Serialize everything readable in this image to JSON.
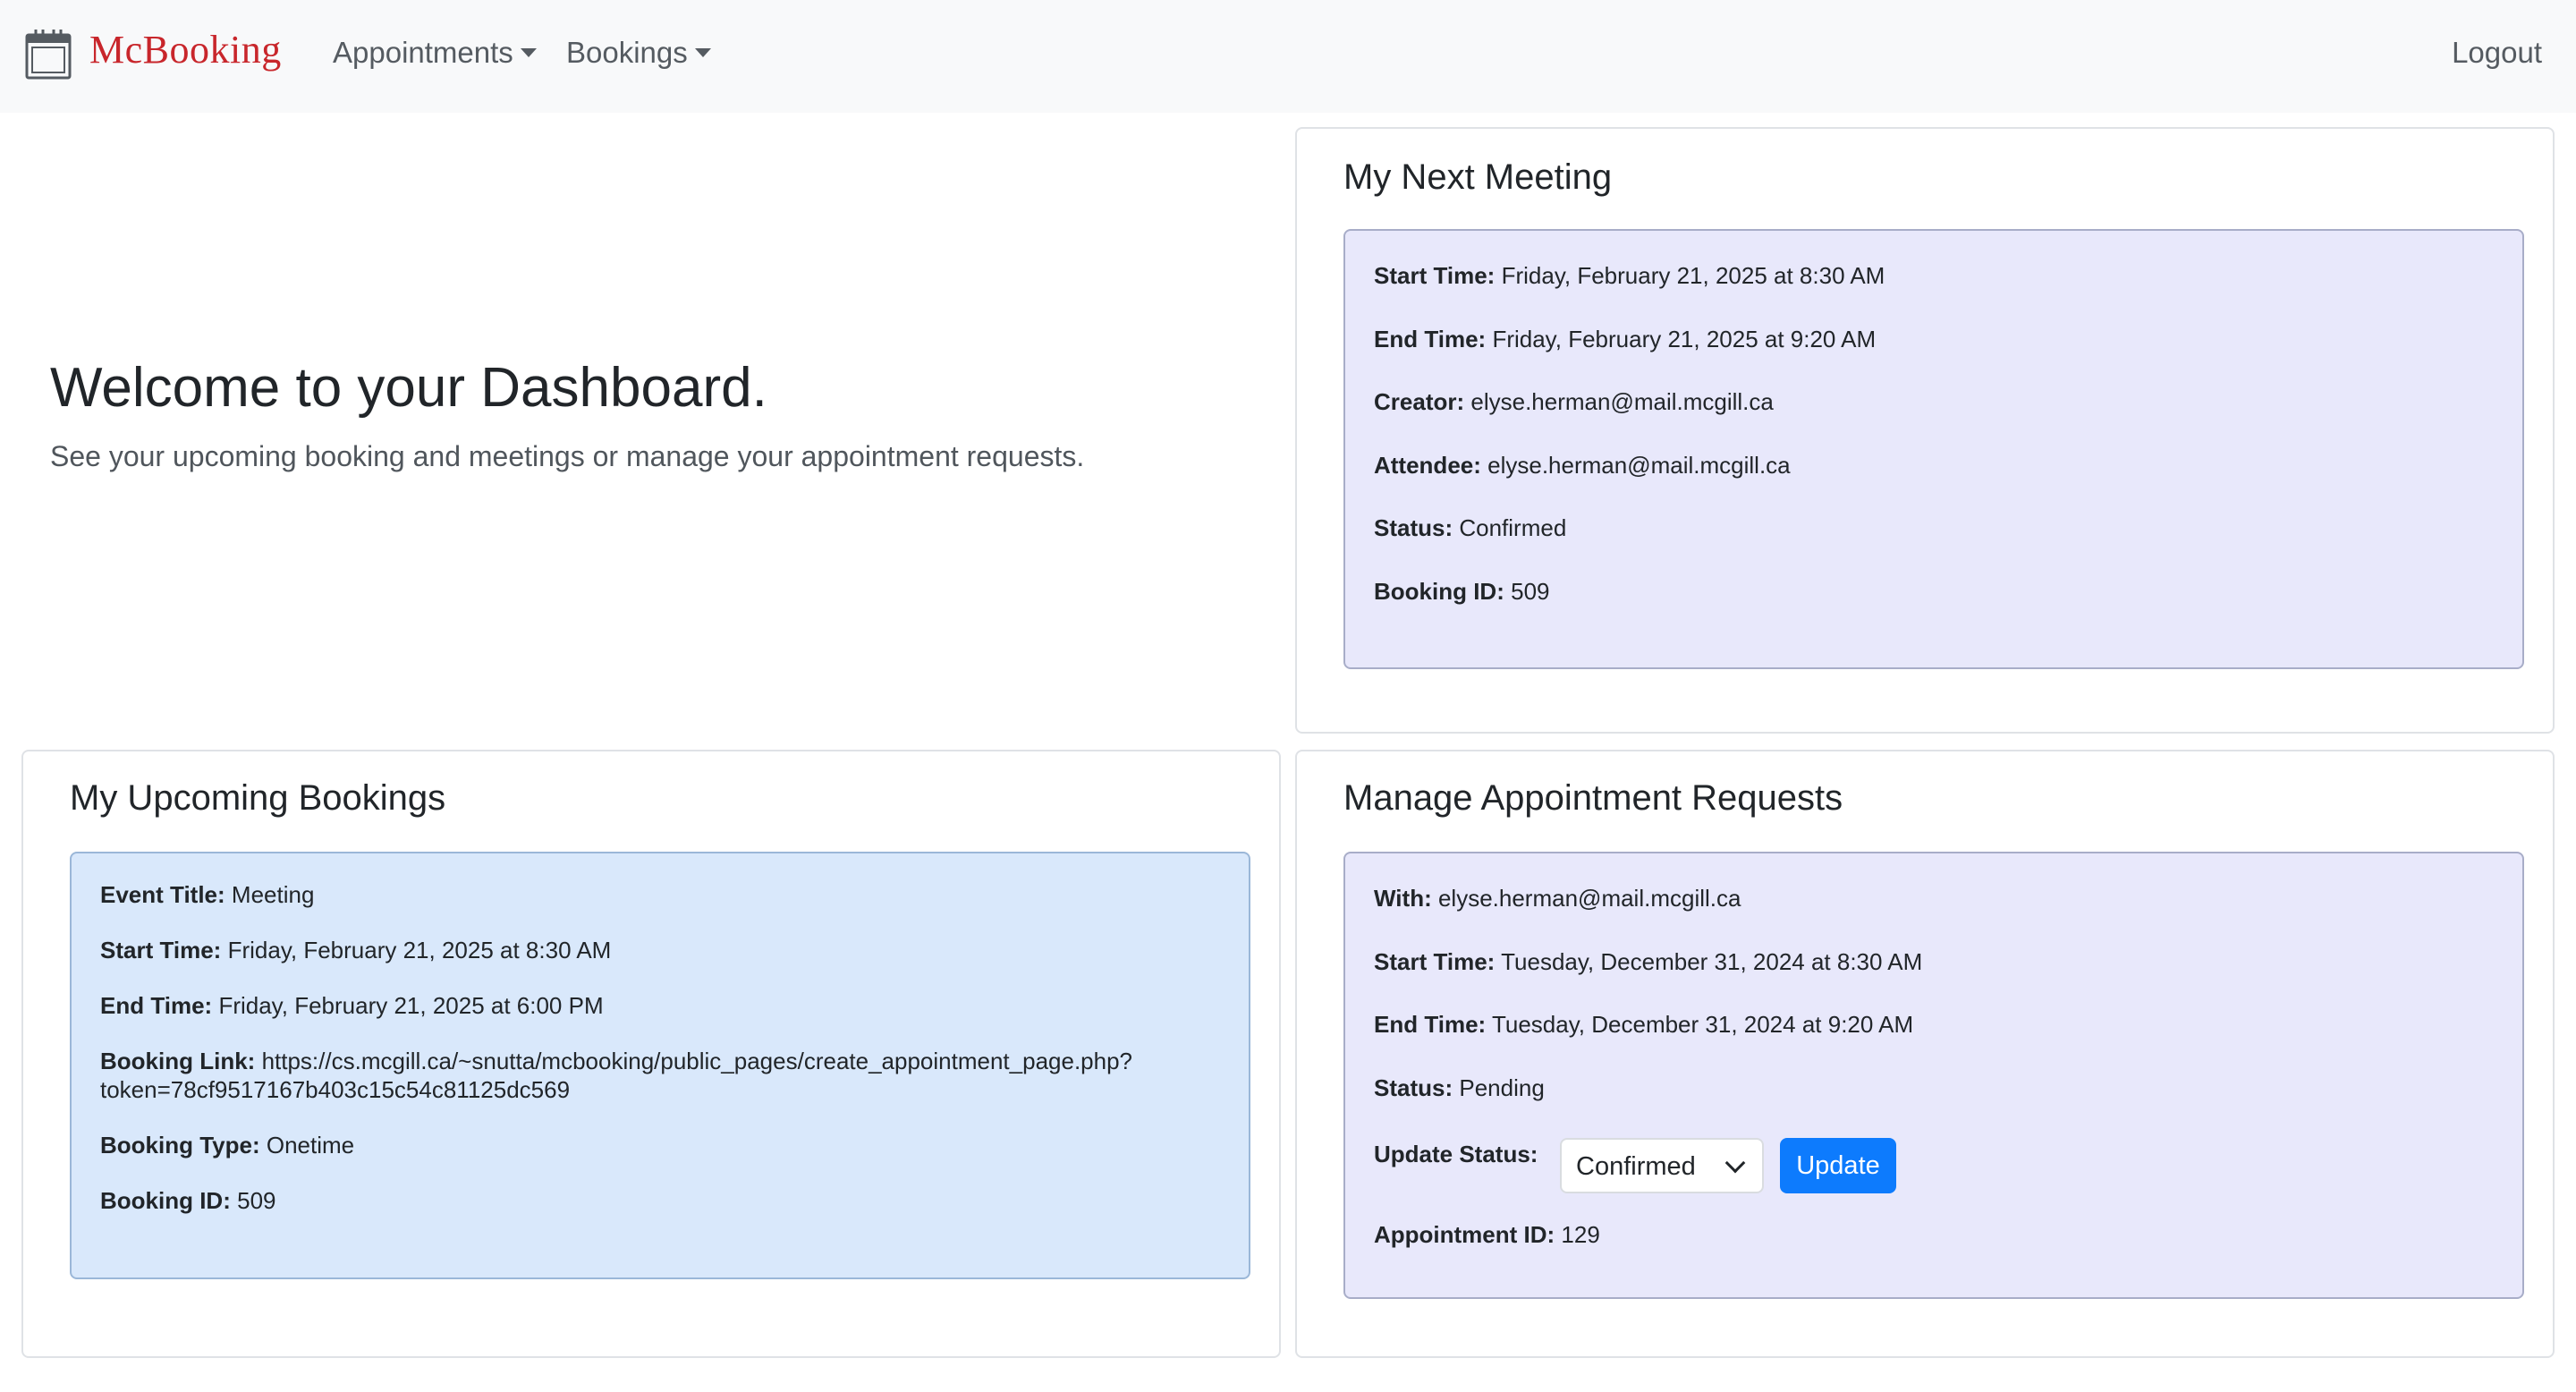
{
  "navbar": {
    "brand": "McBooking",
    "brand_color": "#c8262b",
    "brand_icon": "calendar-icon",
    "appointments_label": "Appointments",
    "bookings_label": "Bookings",
    "logout_label": "Logout"
  },
  "hero": {
    "title": "Welcome to your Dashboard.",
    "subtitle": "See your upcoming booking and meetings or manage your appointment requests."
  },
  "next_meeting": {
    "title": "My Next Meeting",
    "fields": [
      {
        "label": "Start Time:",
        "value": "Friday, February 21, 2025 at 8:30 AM"
      },
      {
        "label": "End Time:",
        "value": "Friday, February 21, 2025 at 9:20 AM"
      },
      {
        "label": "Creator:",
        "value": "elyse.herman@mail.mcgill.ca"
      },
      {
        "label": "Attendee:",
        "value": "elyse.herman@mail.mcgill.ca"
      },
      {
        "label": "Status:",
        "value": "Confirmed"
      },
      {
        "label": "Booking ID:",
        "value": "509"
      }
    ]
  },
  "upcoming_bookings": {
    "title": "My Upcoming Bookings",
    "fields": [
      {
        "label": "Event Title:",
        "value": "Meeting"
      },
      {
        "label": "Start Time:",
        "value": "Friday, February 21, 2025 at 8:30 AM"
      },
      {
        "label": "End Time:",
        "value": "Friday, February 21, 2025 at 6:00 PM"
      },
      {
        "label": "Booking Link:",
        "value": "https://cs.mcgill.ca/~snutta/mcbooking/public_pages/create_appointment_page.php?",
        "value_line2": "token=78cf9517167b403c15c54c81125dc569"
      },
      {
        "label": "Booking Type:",
        "value": "Onetime"
      },
      {
        "label": "Booking ID:",
        "value": "509"
      }
    ]
  },
  "manage_requests": {
    "title": "Manage Appointment Requests",
    "fields": [
      {
        "label": "With:",
        "value": "elyse.herman@mail.mcgill.ca"
      },
      {
        "label": "Start Time:",
        "value": "Tuesday, December 31, 2024 at 8:30 AM"
      },
      {
        "label": "End Time:",
        "value": "Tuesday, December 31, 2024 at 9:20 AM"
      },
      {
        "label": "Status:",
        "value": "Pending"
      }
    ],
    "update_label": "Update Status:",
    "status_select_value": "Confirmed",
    "update_button": "Update",
    "appointment_id_label": "Appointment ID:",
    "appointment_id": "129"
  },
  "colors": {
    "navbar_bg": "#f8f9fa",
    "lavender_panel": "#e8e8fb",
    "blue_panel": "#d9e8fb",
    "primary_button": "#0d7bfd"
  }
}
